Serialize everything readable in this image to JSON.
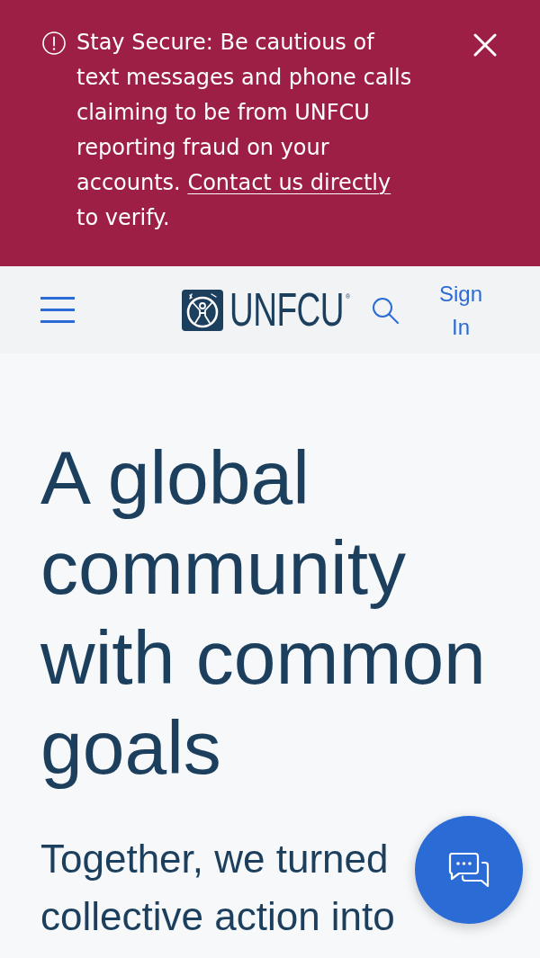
{
  "alert_banner": {
    "message": "Stay Secure: Be cautious of text messages and phone calls claiming to be from UNFCU reporting fraud on your accounts.",
    "link": "Contact us directly",
    "message_end": "to verify."
  },
  "header": {
    "logo_text": "UNFCU",
    "logo_mark": "®",
    "sign_in": "Sign In"
  },
  "hero": {
    "heading": "A global community with common goals",
    "intro": "Together, we turned collective action into"
  }
}
